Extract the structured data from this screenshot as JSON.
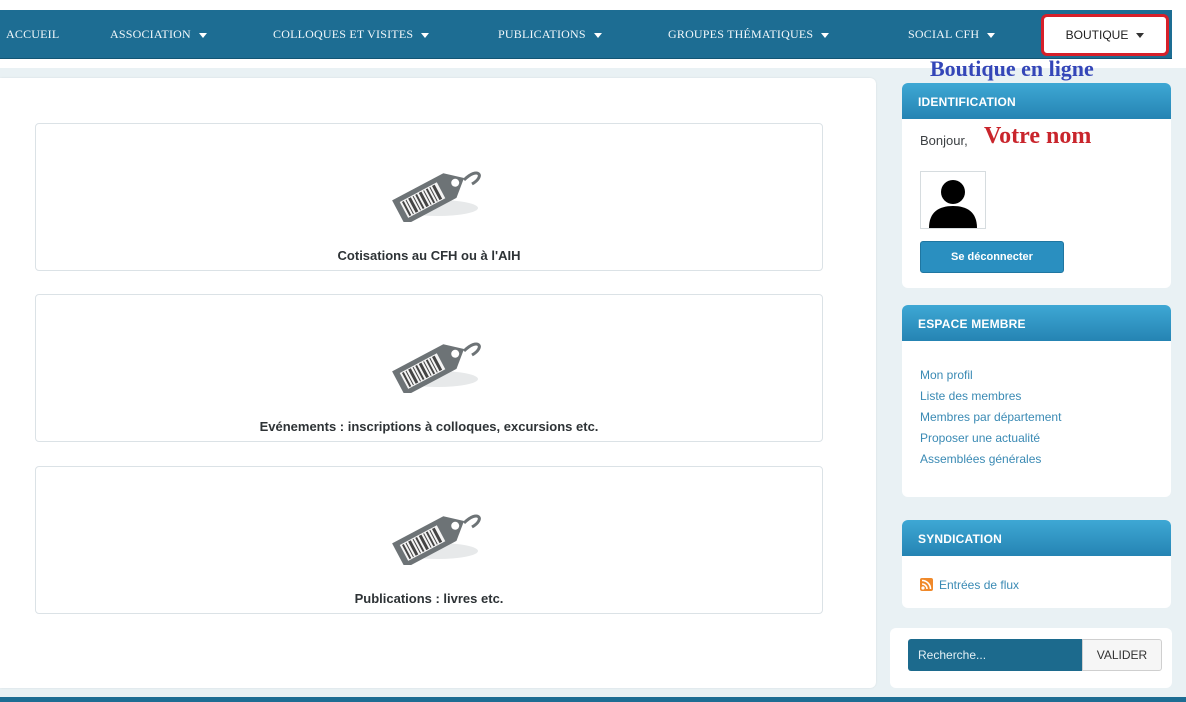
{
  "nav": {
    "items": [
      {
        "label": "ACCUEIL",
        "dropdown": false
      },
      {
        "label": "ASSOCIATION",
        "dropdown": true
      },
      {
        "label": "COLLOQUES ET VISITES",
        "dropdown": true
      },
      {
        "label": "PUBLICATIONS",
        "dropdown": true
      },
      {
        "label": "GROUPES THÉMATIQUES",
        "dropdown": true
      },
      {
        "label": "SOCIAL CFH",
        "dropdown": true
      }
    ],
    "boutique_label": "BOUTIQUE",
    "bar_color": "#1d6d93",
    "highlight_color": "#d6202a"
  },
  "annotations": {
    "boutique": "Boutique en ligne",
    "votre_nom": "Votre nom"
  },
  "categories": [
    {
      "label": "Cotisations au CFH ou à l'AIH",
      "icon": "price-tag-icon"
    },
    {
      "label": "Evénements : inscriptions à colloques, excursions etc.",
      "icon": "price-tag-icon"
    },
    {
      "label": "Publications : livres etc.",
      "icon": "price-tag-icon"
    }
  ],
  "identification": {
    "title": "IDENTIFICATION",
    "greeting": "Bonjour,",
    "avatar_icon": "user-silhouette-icon",
    "logout_label": "Se déconnecter"
  },
  "espace_membre": {
    "title": "ESPACE MEMBRE",
    "links": [
      "Mon profil",
      "Liste des membres",
      "Membres par département",
      "Proposer une actualité",
      "Assemblées générales"
    ]
  },
  "syndication": {
    "title": "SYNDICATION",
    "icon": "rss-icon",
    "link": "Entrées de flux"
  },
  "search": {
    "placeholder": "Recherche...",
    "button_label": "VALIDER"
  },
  "colors": {
    "module_header": "#2a8fc0",
    "link": "#3a8ab4",
    "annotation_blue": "#3446b8",
    "annotation_red": "#c9252c"
  }
}
